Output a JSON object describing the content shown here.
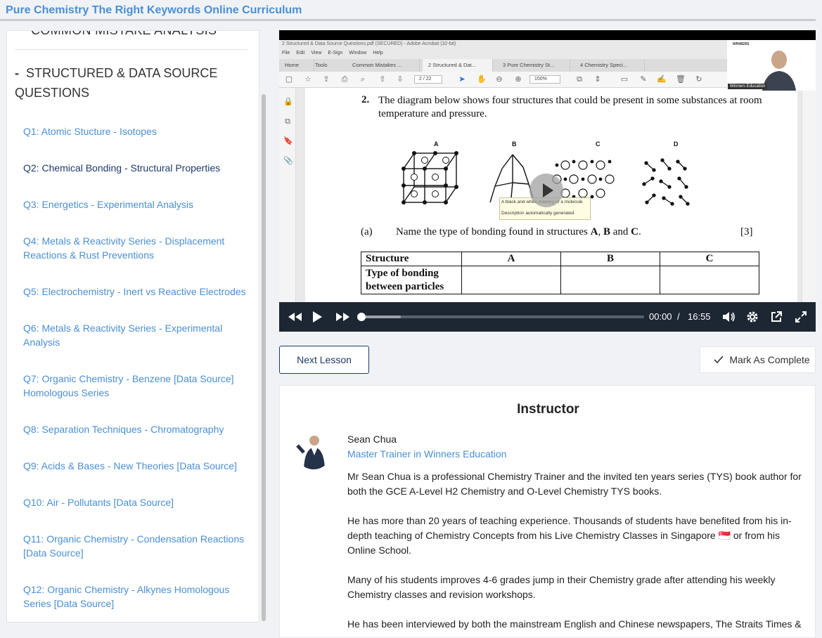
{
  "course": {
    "title": "Pure Chemistry The Right Keywords Online Curriculum"
  },
  "sidebar": {
    "previous_section": "COMMON MISTAKE ANALYSIS",
    "section_marker": "-",
    "section_title": "STRUCTURED & DATA SOURCE QUESTIONS",
    "lessons": [
      {
        "label": "Q1: Atomic Stucture - Isotopes",
        "active": false
      },
      {
        "label": "Q2: Chemical Bonding - Structural Properties",
        "active": true
      },
      {
        "label": "Q3: Energetics - Experimental Analysis",
        "active": false
      },
      {
        "label": "Q4: Metals & Reactivity Series - Displacement Reactions & Rust Preventions",
        "active": false
      },
      {
        "label": "Q5: Electrochemistry - Inert vs Reactive Electrodes",
        "active": false
      },
      {
        "label": "Q6: Metals & Reactivity Series - Experimental Analysis",
        "active": false
      },
      {
        "label": "Q7: Organic Chemistry - Benzene [Data Source] Homologous Series",
        "active": false
      },
      {
        "label": "Q8: Separation Techniques - Chromatography",
        "active": false
      },
      {
        "label": "Q9: Acids & Bases - New Theories [Data Source]",
        "active": false
      },
      {
        "label": "Q10: Air - Pollutants [Data Source]",
        "active": false
      },
      {
        "label": "Q11: Organic Chemistry - Condensation Reactions [Data Source]",
        "active": false
      },
      {
        "label": "Q12: Organic Chemistry - Alkynes Homologous Series [Data Source]",
        "active": false
      }
    ]
  },
  "video": {
    "acrobat_title": "2 Structured & Data Source Questions.pdf (SECURED) - Adobe Acrobat (32-bit)",
    "acrobat_menu": [
      "File",
      "Edit",
      "View",
      "E-Sign",
      "Window",
      "Help"
    ],
    "acrobat_tabs": [
      "Home",
      "Tools",
      "Common Mistakes ...",
      "2 Structured & Dat...",
      "3 Pure Chemistry St...",
      "4 Chemistry Speci..."
    ],
    "page_box": "2 / 22",
    "zoom": "150%",
    "question_number": "2.",
    "question_text": "The diagram below shows four structures that could be present in some substances at room temperature and pressure.",
    "structure_labels": [
      "A",
      "B",
      "C",
      "D"
    ],
    "tooltip": "A black and white drawing of a molecule\n\nDescription automatically generated",
    "part_label": "(a)",
    "part_text_before": "Name the type of bonding found in structures ",
    "part_text_a": "A",
    "part_text_comma": ", ",
    "part_text_b": "B",
    "part_text_and": " and ",
    "part_text_c": "C",
    "part_text_end": ".",
    "part_marks": "[3]",
    "table_header": [
      "Structure",
      "A",
      "B",
      "C"
    ],
    "table_row": "Type of bonding between particles",
    "webcam_label": "Winners Education",
    "webcam_logo": "WINNERS",
    "current_time": "00:00",
    "separator": "/",
    "duration": "16:55",
    "progress": 0.0,
    "buffered": 0.14
  },
  "buttons": {
    "next_lesson": "Next Lesson",
    "mark_complete": "Mark As Complete"
  },
  "instructor": {
    "heading": "Instructor",
    "name": "Sean Chua",
    "role": "Master Trainer in Winners Education",
    "bio_1": "Mr Sean Chua is a professional Chemistry Trainer and the invited ten years series (TYS) book author for both the GCE A-Level H2 Chemistry and O-Level Chemistry TYS books.",
    "bio_2": "He has more than 20 years of teaching experience. Thousands of students have benefited from his in-depth teaching of Chemistry Concepts from his Live Chemistry Classes in Singapore 🇸🇬 or from his Online School.",
    "bio_3": "Many of his students improves 4-6 grades jump in their Chemistry grade after attending his weekly Chemistry classes and revision workshops.",
    "bio_4": "He has been interviewed by both the mainstream English and Chinese newspapers, The Straits Times &"
  },
  "colors": {
    "accent": "#4a8fd4",
    "navy": "#1e3a6b",
    "player_bar": "#1d2633"
  }
}
